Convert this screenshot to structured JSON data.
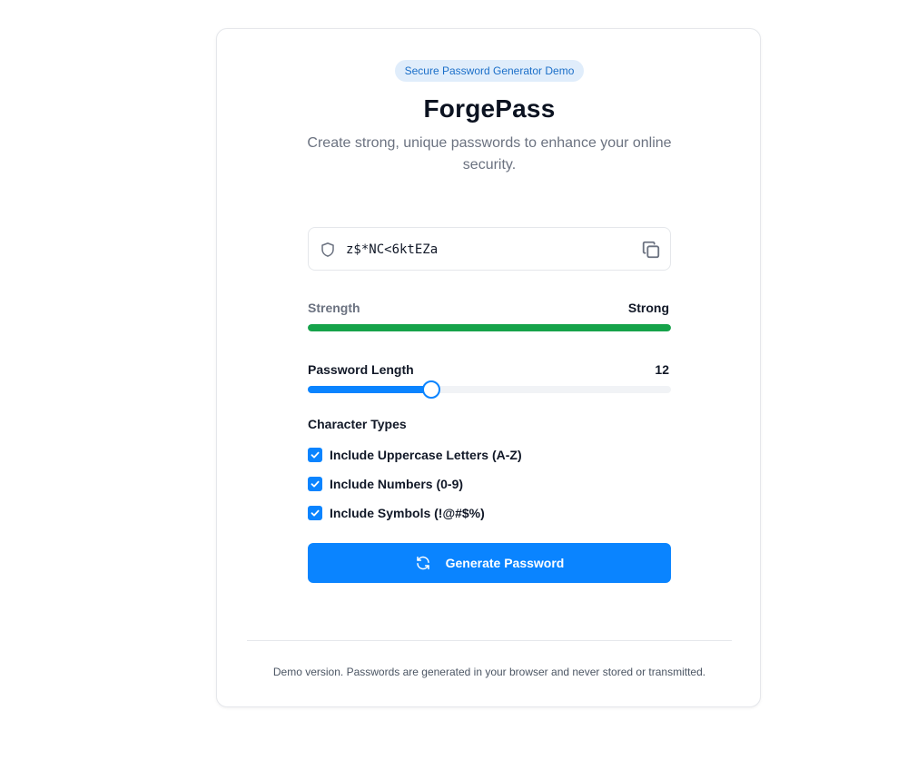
{
  "badge": "Secure Password Generator Demo",
  "title": "ForgePass",
  "subtitle": "Create strong, unique passwords to enhance your online security.",
  "password": {
    "value": "z$*NC<6ktEZa",
    "shield_icon": "shield-icon",
    "copy_icon": "copy-icon"
  },
  "strength": {
    "label": "Strength",
    "value": "Strong",
    "level_fraction": 1.0,
    "color": "#16a34a"
  },
  "length": {
    "label": "Password Length",
    "value": "12",
    "slider_fraction": 0.34
  },
  "character_types": {
    "heading": "Character Types",
    "options": [
      {
        "label": "Include Uppercase Letters (A-Z)",
        "checked": true
      },
      {
        "label": "Include Numbers (0-9)",
        "checked": true
      },
      {
        "label": "Include Symbols (!@#$%)",
        "checked": true
      }
    ]
  },
  "generate": {
    "label": "Generate Password",
    "icon": "refresh-icon"
  },
  "footer": "Demo version. Passwords are generated in your browser and never stored or transmitted.",
  "colors": {
    "accent": "#0a84ff",
    "badge_bg": "#e0edfb",
    "badge_text": "#1b6fc9"
  }
}
